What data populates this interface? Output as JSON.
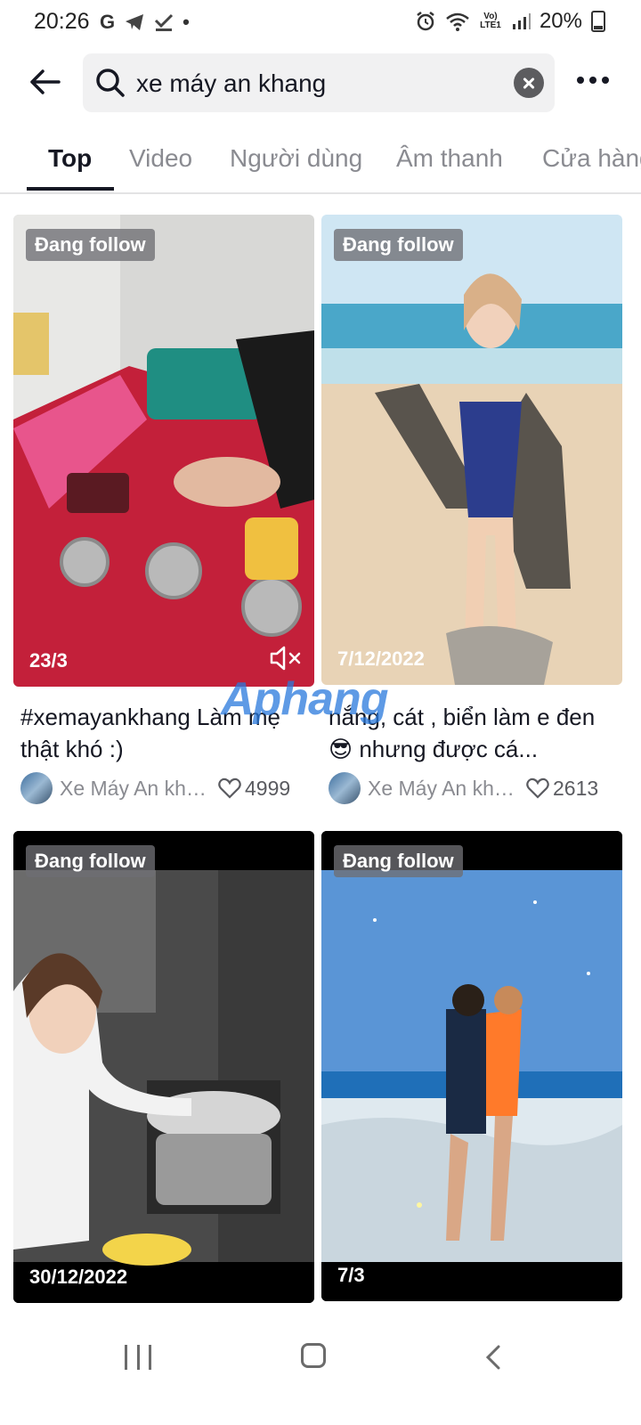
{
  "status_bar": {
    "time": "20:26",
    "left_icons": [
      "G",
      "telegram-icon",
      "check-icon",
      "•"
    ],
    "signal": "Vo) LTE1",
    "battery": "20%"
  },
  "search": {
    "query": "xe máy an khang"
  },
  "tabs": [
    {
      "label": "Top",
      "active": true
    },
    {
      "label": "Video"
    },
    {
      "label": "Người dùng"
    },
    {
      "label": "Âm thanh"
    },
    {
      "label": "Cửa hàng"
    }
  ],
  "watermark": {
    "part1": "Aphang",
    "part2": ""
  },
  "results": [
    {
      "badge": "Đang follow",
      "date": "23/3",
      "caption": "#xemayankhang Làm mẹ thật khó :)",
      "author": "Xe Máy An khang",
      "likes": "4999",
      "muted": true,
      "image_colors": [
        "#d9d9d9",
        "#c2223a",
        "#e85a8a"
      ]
    },
    {
      "badge": "Đang follow",
      "date": "7/12/2022",
      "caption": "nắng, cát , biển làm e đen 😎 nhưng được cá...",
      "author": "Xe Máy An khang",
      "likes": "2613",
      "image_colors": [
        "#cfe6f3",
        "#4aa7c9",
        "#e8d3b6"
      ]
    },
    {
      "badge": "Đang follow",
      "date": "30/12/2022",
      "image_colors": [
        "#3a3a3a",
        "#8c8c8c",
        "#f0f0f0"
      ]
    },
    {
      "badge": "Đang follow",
      "date": "7/3",
      "image_colors": [
        "#5a95d6",
        "#1f6fb8",
        "#dfe9ef"
      ]
    }
  ],
  "nav": {
    "icons": [
      "recents-icon",
      "home-icon",
      "back-icon"
    ]
  }
}
